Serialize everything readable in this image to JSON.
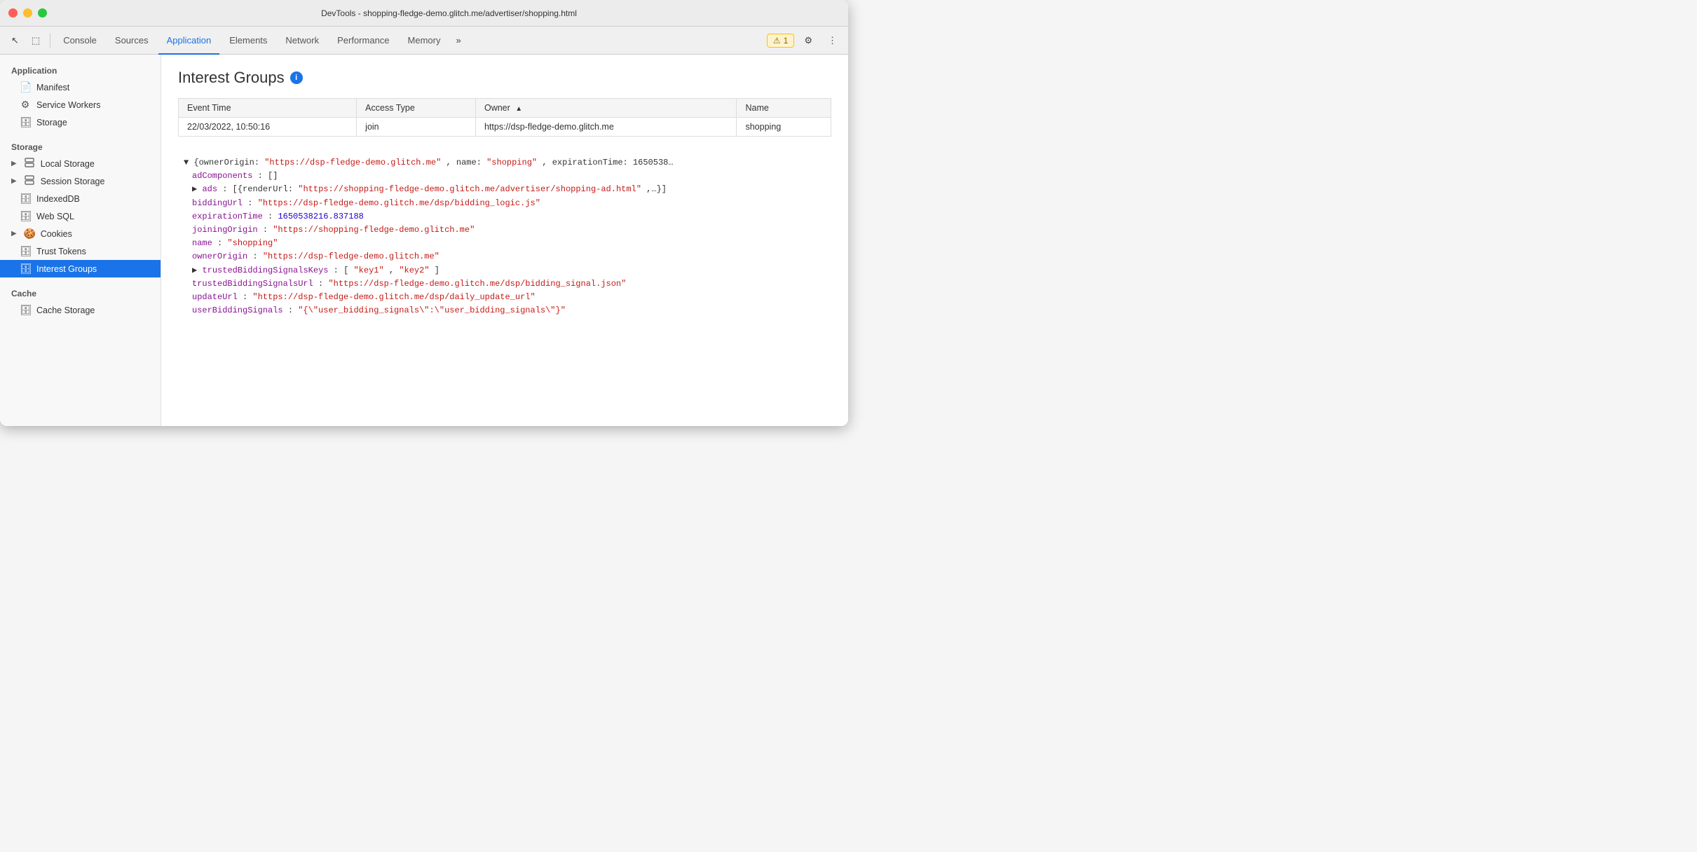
{
  "window": {
    "title": "DevTools - shopping-fledge-demo.glitch.me/advertiser/shopping.html"
  },
  "toolbar": {
    "tabs": [
      {
        "id": "console",
        "label": "Console",
        "active": false
      },
      {
        "id": "sources",
        "label": "Sources",
        "active": false
      },
      {
        "id": "application",
        "label": "Application",
        "active": true
      },
      {
        "id": "elements",
        "label": "Elements",
        "active": false
      },
      {
        "id": "network",
        "label": "Network",
        "active": false
      },
      {
        "id": "performance",
        "label": "Performance",
        "active": false
      },
      {
        "id": "memory",
        "label": "Memory",
        "active": false
      }
    ],
    "more_label": "»",
    "warning_count": "1",
    "warning_icon": "⚠",
    "gear_icon": "⚙",
    "more_icon": "⋮"
  },
  "sidebar": {
    "app_section": "Application",
    "app_items": [
      {
        "id": "manifest",
        "label": "Manifest",
        "icon": "📄"
      },
      {
        "id": "service-workers",
        "label": "Service Workers",
        "icon": "⚙"
      },
      {
        "id": "storage",
        "label": "Storage",
        "icon": "🗄"
      }
    ],
    "storage_section": "Storage",
    "storage_items": [
      {
        "id": "local-storage",
        "label": "Local Storage",
        "icon": "▦",
        "has_arrow": true
      },
      {
        "id": "session-storage",
        "label": "Session Storage",
        "icon": "▦",
        "has_arrow": true
      },
      {
        "id": "indexed-db",
        "label": "IndexedDB",
        "icon": "🗄"
      },
      {
        "id": "web-sql",
        "label": "Web SQL",
        "icon": "🗄"
      },
      {
        "id": "cookies",
        "label": "Cookies",
        "icon": "🍪",
        "has_arrow": true
      },
      {
        "id": "trust-tokens",
        "label": "Trust Tokens",
        "icon": "🗄"
      },
      {
        "id": "interest-groups",
        "label": "Interest Groups",
        "icon": "🗄",
        "active": true
      }
    ],
    "cache_section": "Cache",
    "cache_items": [
      {
        "id": "cache-storage",
        "label": "Cache Storage",
        "icon": "🗄"
      }
    ]
  },
  "main": {
    "page_title": "Interest Groups",
    "table": {
      "columns": [
        {
          "id": "event_time",
          "label": "Event Time",
          "sortable": false
        },
        {
          "id": "access_type",
          "label": "Access Type",
          "sortable": false
        },
        {
          "id": "owner",
          "label": "Owner",
          "sortable": true
        },
        {
          "id": "name",
          "label": "Name",
          "sortable": false
        }
      ],
      "rows": [
        {
          "event_time": "22/03/2022, 10:50:16",
          "access_type": "join",
          "owner": "https://dsp-fledge-demo.glitch.me",
          "name": "shopping"
        }
      ]
    },
    "json_lines": [
      {
        "indent": 0,
        "content": "▼ {ownerOrigin: \"https://dsp-fledge-demo.glitch.me\", name: \"shopping\", expirationTime: 1650538…",
        "type": "bracket"
      },
      {
        "indent": 1,
        "key": "adComponents",
        "value": "[]",
        "value_type": "bracket"
      },
      {
        "indent": 1,
        "content": "▶ ads: [{renderUrl: \"https://shopping-fledge-demo.glitch.me/advertiser/shopping-ad.html\",…}]",
        "type": "expandable"
      },
      {
        "indent": 1,
        "key": "biddingUrl",
        "value": "\"https://dsp-fledge-demo.glitch.me/dsp/bidding_logic.js\"",
        "value_type": "string"
      },
      {
        "indent": 1,
        "key": "expirationTime",
        "value": "1650538216.837188",
        "value_type": "number"
      },
      {
        "indent": 1,
        "key": "joiningOrigin",
        "value": "\"https://shopping-fledge-demo.glitch.me\"",
        "value_type": "string"
      },
      {
        "indent": 1,
        "key": "name",
        "value": "\"shopping\"",
        "value_type": "string"
      },
      {
        "indent": 1,
        "key": "ownerOrigin",
        "value": "\"https://dsp-fledge-demo.glitch.me\"",
        "value_type": "string"
      },
      {
        "indent": 1,
        "content": "▶ trustedBiddingSignalsKeys: [\"key1\", \"key2\"]",
        "type": "expandable"
      },
      {
        "indent": 1,
        "key": "trustedBiddingSignalsUrl",
        "value": "\"https://dsp-fledge-demo.glitch.me/dsp/bidding_signal.json\"",
        "value_type": "string"
      },
      {
        "indent": 1,
        "key": "updateUrl",
        "value": "\"https://dsp-fledge-demo.glitch.me/dsp/daily_update_url\"",
        "value_type": "string"
      },
      {
        "indent": 1,
        "key": "userBiddingSignals",
        "value": "\"{\\\"user_bidding_signals\\\":\\\"user_bidding_signals\\\"}\"",
        "value_type": "string"
      }
    ]
  }
}
